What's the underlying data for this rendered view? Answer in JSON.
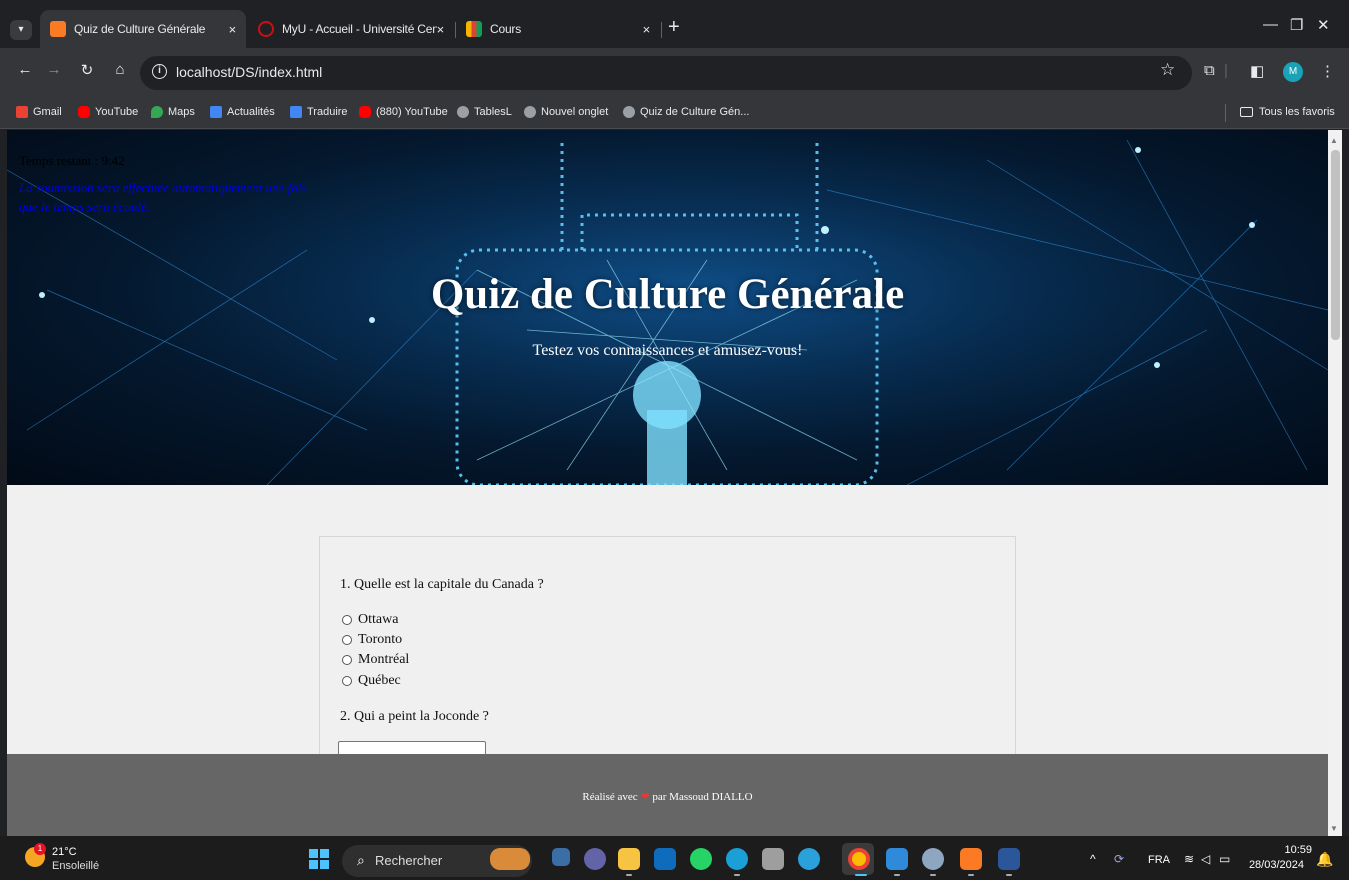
{
  "browser": {
    "tabs": [
      {
        "title": "Quiz de Culture Générale",
        "favicon": "xampp-icon",
        "color": "#fb7a24",
        "active": true
      },
      {
        "title": "MyU - Accueil - Université Cent",
        "favicon": "opera-icon",
        "color": "#cc0f16",
        "active": false
      },
      {
        "title": "Cours",
        "favicon": "chart-icon",
        "color": "#f4b400",
        "active": false
      }
    ],
    "new_tab_label": "+",
    "close_label": "×",
    "url": "localhost/DS/index.html",
    "profile_initial": "M",
    "bookmarks": [
      {
        "label": "Gmail",
        "icon": "gmail-icon",
        "color": "#ea4335"
      },
      {
        "label": "YouTube",
        "icon": "youtube-icon",
        "color": "#ff0000"
      },
      {
        "label": "Maps",
        "icon": "maps-icon",
        "color": "#34a853"
      },
      {
        "label": "Actualités",
        "icon": "news-icon",
        "color": "#4285f4"
      },
      {
        "label": "Traduire",
        "icon": "translate-icon",
        "color": "#4285f4"
      },
      {
        "label": "(880) YouTube",
        "icon": "youtube-icon",
        "color": "#ff0000"
      },
      {
        "label": "TablesL",
        "icon": "globe-icon",
        "color": "#9aa0a6"
      },
      {
        "label": "Nouvel onglet",
        "icon": "globe-icon",
        "color": "#9aa0a6"
      },
      {
        "label": "Quiz de Culture Gén...",
        "icon": "globe-icon",
        "color": "#9aa0a6"
      }
    ],
    "all_bookmarks_label": "Tous les favoris"
  },
  "page": {
    "timer": "Temps restant : 9:42",
    "timer_note": "La soumission sera effectuée automatiquement une fois que le temps sera écoulé.",
    "title": "Quiz de Culture Générale",
    "subtitle": "Testez vos connaissances et amusez-vous!",
    "questions": [
      {
        "text": "1. Quelle est la capitale du Canada ?",
        "options": [
          "Ottawa",
          "Toronto",
          "Montréal",
          "Québec"
        ]
      },
      {
        "text": "2. Qui a peint la Joconde ?",
        "answer_value": ""
      }
    ],
    "footer": {
      "prefix": "Réalisé avec",
      "heart": "❤",
      "suffix": "par Massoud DIALLO",
      "heart_color": "#e53935"
    }
  },
  "taskbar": {
    "weather_temp": "21°C",
    "weather_condition": "Ensoleillé",
    "weather_badge": "1",
    "search_placeholder": "Rechercher",
    "language": "FRA",
    "time": "10:59",
    "date": "28/03/2024",
    "apps": [
      {
        "name": "widgets-icon",
        "color": "#d98b3a"
      },
      {
        "name": "task-view-icon",
        "color": "#3a6ea5"
      },
      {
        "name": "teams-icon",
        "color": "#6264a7"
      },
      {
        "name": "file-explorer-icon",
        "color": "#f6c342"
      },
      {
        "name": "mail-icon",
        "color": "#0f6cbd"
      },
      {
        "name": "whatsapp-icon",
        "color": "#25d366"
      },
      {
        "name": "edge-icon",
        "color": "#1a9fd6"
      },
      {
        "name": "virtualbox-icon",
        "color": "#9e9e9e"
      },
      {
        "name": "telegram-icon",
        "color": "#2aa1da"
      },
      {
        "name": "chrome-icon",
        "color": "#fbbc04"
      },
      {
        "name": "vscode-icon",
        "color": "#2f8bd9"
      },
      {
        "name": "settings-icon",
        "color": "#8ea6c0"
      },
      {
        "name": "xampp-icon",
        "color": "#fb7a24"
      },
      {
        "name": "word-icon",
        "color": "#2b579a"
      }
    ]
  }
}
